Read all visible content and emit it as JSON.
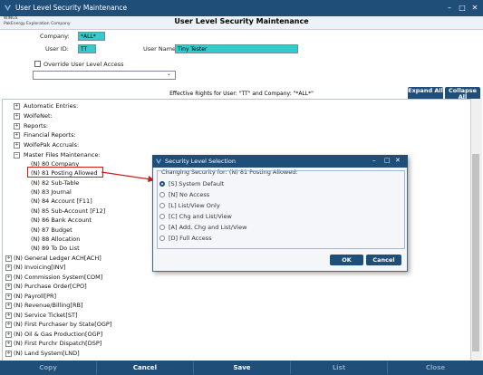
{
  "window": {
    "title": "User Level Security Maintenance"
  },
  "company_info": {
    "line1": "WINGS",
    "line2": "PakEnergy Exploration Company"
  },
  "header": {
    "title": "User Level Security Maintenance"
  },
  "form": {
    "company_label": "Company:",
    "company_value": "*ALL*",
    "user_id_label": "User ID:",
    "user_id_value": "TT",
    "user_name_label": "User Name:",
    "user_name_value": "Tiny Tester",
    "override_label": "Override User Level Access",
    "effective_rights": "Effective Rights for User: \"TT\" and Company: \"*ALL*\""
  },
  "buttons": {
    "expand_all": "Expand All",
    "collapse_all": "Collapse All"
  },
  "tree": {
    "top_items": [
      "Automatic Entries:",
      "WolfeNet:",
      "Reports:",
      "Financial Reports:",
      "WolfePak Accruals:",
      "Master Files Maintenance:"
    ],
    "master_children": [
      "(N) 80 Company",
      "(N) 81 Posting Allowed",
      "(N) 82 Sub-Table",
      "(N) 83 Journal",
      "(N) 84 Account [F11]",
      "(N) 85 Sub-Account [F12]",
      "(N) 86 Bank Account",
      "(N) 87 Budget",
      "(N) 88 Allocation",
      "(N) 89 To Do List"
    ],
    "modules": [
      "(N) General Ledger ACH[ACH]",
      "(N) Invoicing[INV]",
      "(N) Commission System[COM]",
      "(N) Purchase Order[CPO]",
      "(N) Payroll[PR]",
      "(N) Revenue/Billing[RB]",
      "(N) Service Ticket[ST]",
      "(N) First Purchaser by State[OGP]",
      "(N) Oil & Gas Production[OGP]",
      "(N) First Purchr Dispatch[DSP]",
      "(N) Land System[LND]"
    ]
  },
  "dialog": {
    "title": "Security Level Selection",
    "group_label": "Changing Security for: (N) 81 Posting Allowed:",
    "options": [
      "[S] System Default",
      "[N] No Access",
      "[L] List/View Only",
      "[C] Chg and List/View",
      "[A] Add, Chg and List/View",
      "[D] Full Access"
    ],
    "selected": "[S] System Default",
    "ok": "OK",
    "cancel": "Cancel"
  },
  "toolbar": {
    "copy": "Copy",
    "cancel": "Cancel",
    "save": "Save",
    "list": "List",
    "close": "Close"
  },
  "colors": {
    "brand": "#1f4e79",
    "field_highlight": "#33cccc",
    "annotation": "#d01b1b"
  }
}
